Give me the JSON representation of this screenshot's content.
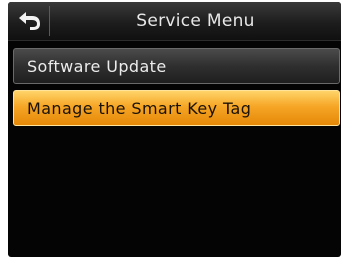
{
  "header": {
    "back_icon": "back-arrow-icon",
    "title": "Service Menu"
  },
  "menu": {
    "items": [
      {
        "label": "Software Update",
        "selected": false
      },
      {
        "label": "Manage the Smart Key Tag",
        "selected": true
      }
    ]
  },
  "colors": {
    "background": "#040404",
    "selected_item": "#f6a626",
    "item_text": "#ececec",
    "selected_text": "#1a1204"
  }
}
